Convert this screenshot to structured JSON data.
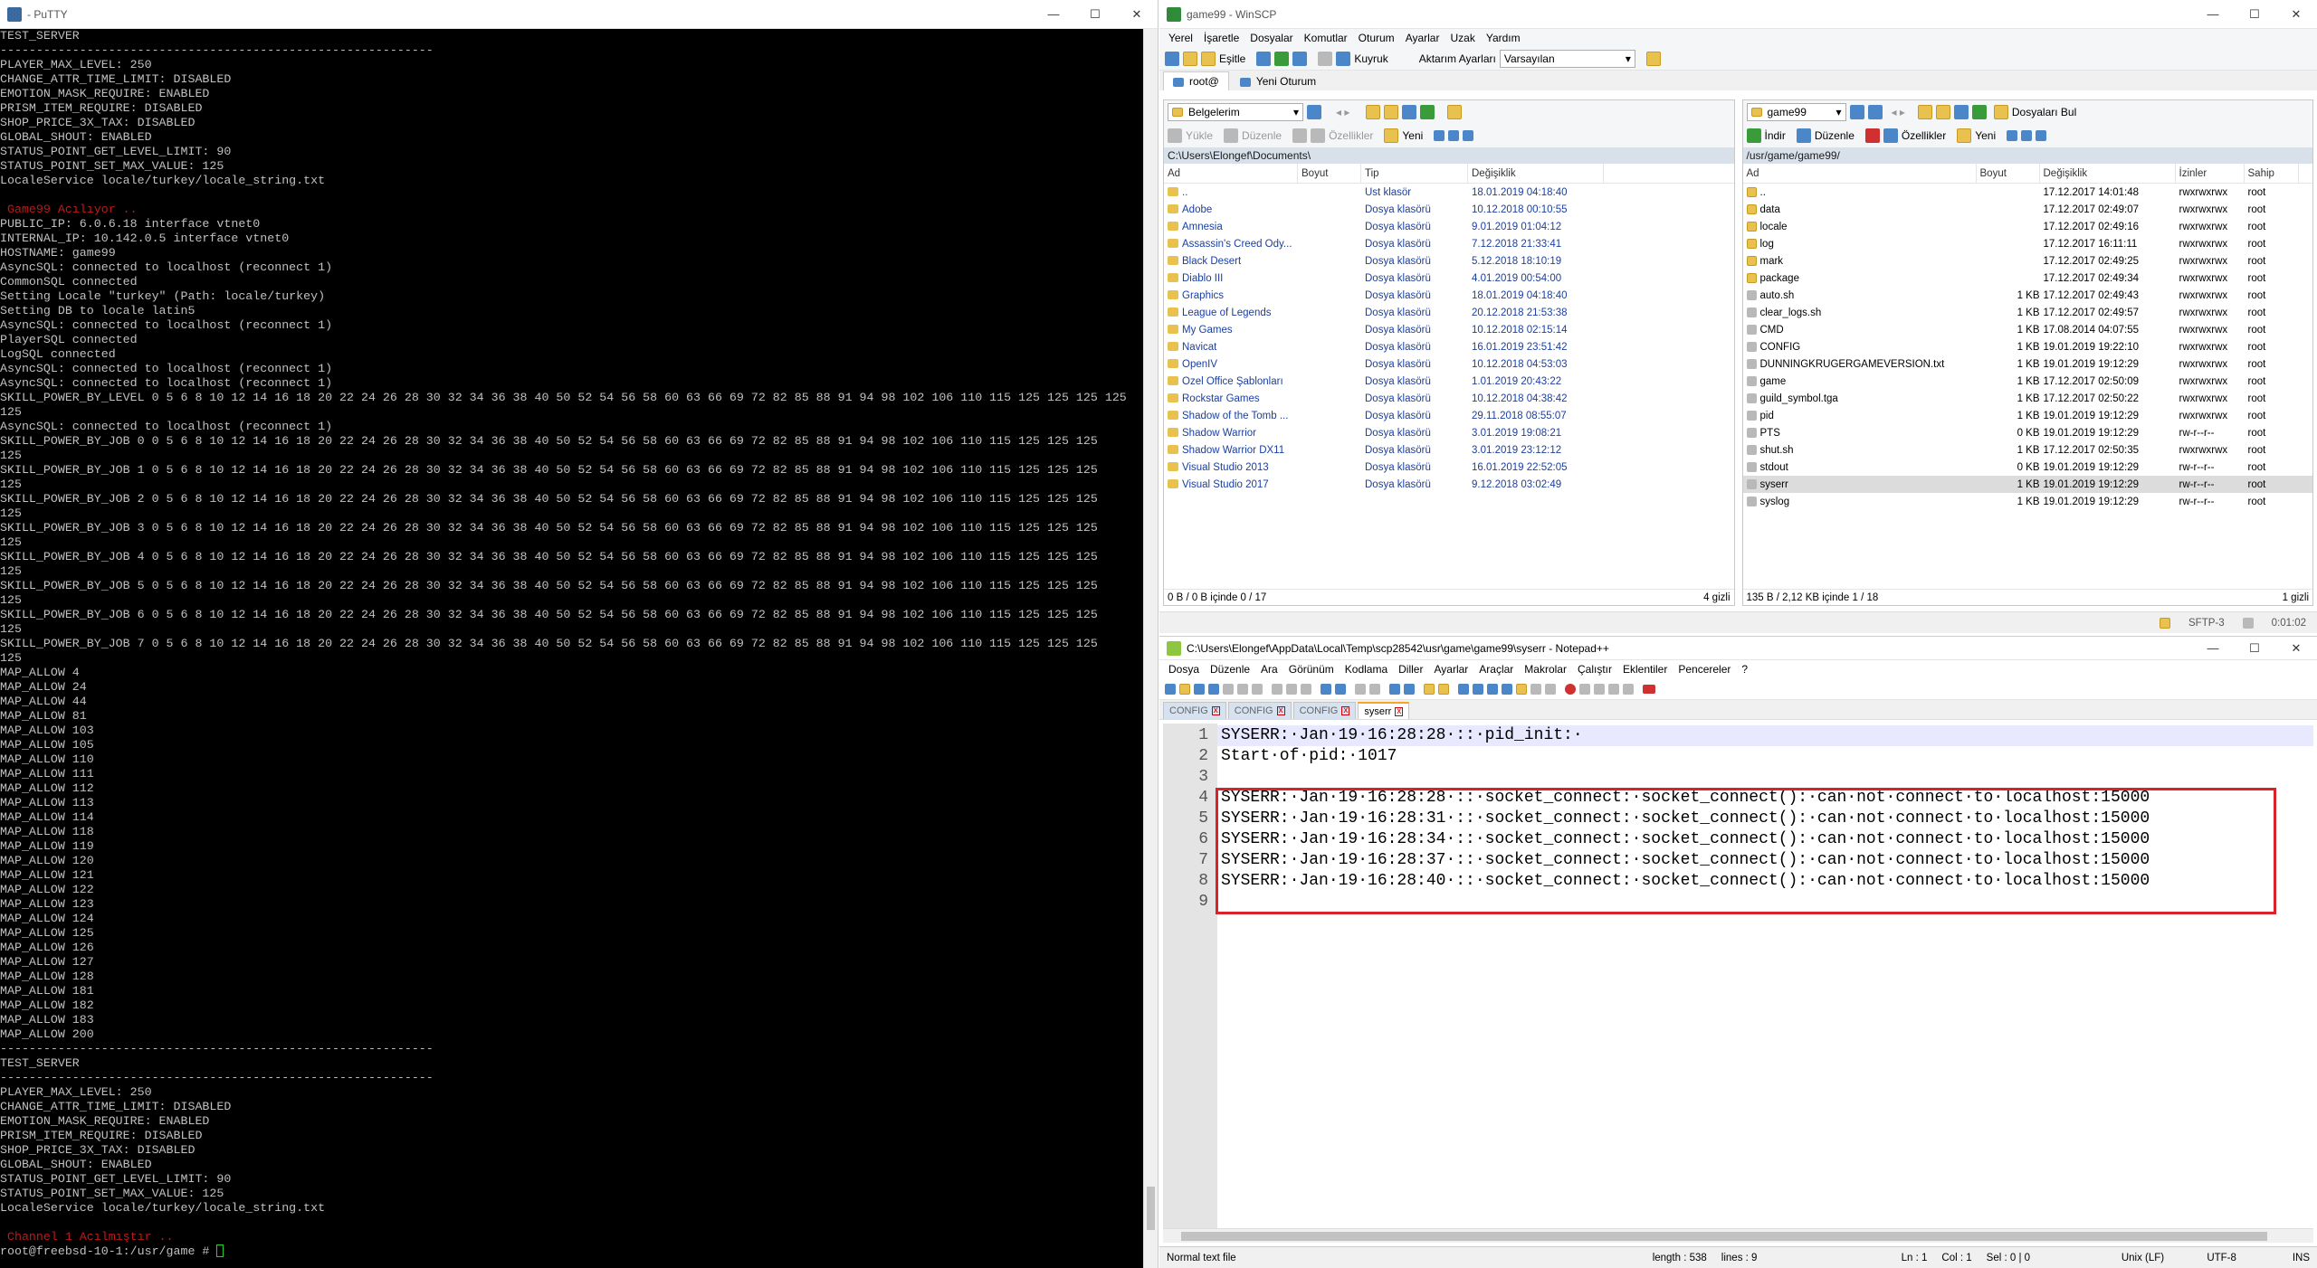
{
  "putty": {
    "title": "- PuTTY",
    "controls": {
      "minimize": "—",
      "maximize": "☐",
      "close": "✕"
    },
    "lines": [
      {
        "t": "TEST_SERVER"
      },
      {
        "t": "------------------------------------------------------------"
      },
      {
        "t": "PLAYER_MAX_LEVEL: 250"
      },
      {
        "t": "CHANGE_ATTR_TIME_LIMIT: DISABLED"
      },
      {
        "t": "EMOTION_MASK_REQUIRE: ENABLED"
      },
      {
        "t": "PRISM_ITEM_REQUIRE: DISABLED"
      },
      {
        "t": "SHOP_PRICE_3X_TAX: DISABLED"
      },
      {
        "t": "GLOBAL_SHOUT: ENABLED"
      },
      {
        "t": "STATUS_POINT_GET_LEVEL_LIMIT: 90"
      },
      {
        "t": "STATUS_POINT_SET_MAX_VALUE: 125"
      },
      {
        "t": "LocaleService locale/turkey/locale_string.txt"
      },
      {
        "t": ""
      },
      {
        "t": " Game99 Acılıyor ..",
        "red": true
      },
      {
        "t": "PUBLIC_IP: 6.0.6.18 interface vtnet0"
      },
      {
        "t": "INTERNAL_IP: 10.142.0.5 interface vtnet0"
      },
      {
        "t": "HOSTNAME: game99"
      },
      {
        "t": "AsyncSQL: connected to localhost (reconnect 1)"
      },
      {
        "t": "CommonSQL connected"
      },
      {
        "t": "Setting Locale \"turkey\" (Path: locale/turkey)"
      },
      {
        "t": "Setting DB to locale latin5"
      },
      {
        "t": "AsyncSQL: connected to localhost (reconnect 1)"
      },
      {
        "t": "PlayerSQL connected"
      },
      {
        "t": "LogSQL connected"
      },
      {
        "t": "AsyncSQL: connected to localhost (reconnect 1)"
      },
      {
        "t": "AsyncSQL: connected to localhost (reconnect 1)"
      },
      {
        "t": "SKILL_POWER_BY_LEVEL 0 5 6 8 10 12 14 16 18 20 22 24 26 28 30 32 34 36 38 40 50 52 54 56 58 60 63 66 69 72 82 85 88 91 94 98 102 106 110 115 125 125 125 125"
      },
      {
        "t": "125"
      },
      {
        "t": "AsyncSQL: connected to localhost (reconnect 1)"
      },
      {
        "t": "SKILL_POWER_BY_JOB 0 0 5 6 8 10 12 14 16 18 20 22 24 26 28 30 32 34 36 38 40 50 52 54 56 58 60 63 66 69 72 82 85 88 91 94 98 102 106 110 115 125 125 125"
      },
      {
        "t": "125"
      },
      {
        "t": "SKILL_POWER_BY_JOB 1 0 5 6 8 10 12 14 16 18 20 22 24 26 28 30 32 34 36 38 40 50 52 54 56 58 60 63 66 69 72 82 85 88 91 94 98 102 106 110 115 125 125 125"
      },
      {
        "t": "125"
      },
      {
        "t": "SKILL_POWER_BY_JOB 2 0 5 6 8 10 12 14 16 18 20 22 24 26 28 30 32 34 36 38 40 50 52 54 56 58 60 63 66 69 72 82 85 88 91 94 98 102 106 110 115 125 125 125"
      },
      {
        "t": "125"
      },
      {
        "t": "SKILL_POWER_BY_JOB 3 0 5 6 8 10 12 14 16 18 20 22 24 26 28 30 32 34 36 38 40 50 52 54 56 58 60 63 66 69 72 82 85 88 91 94 98 102 106 110 115 125 125 125"
      },
      {
        "t": "125"
      },
      {
        "t": "SKILL_POWER_BY_JOB 4 0 5 6 8 10 12 14 16 18 20 22 24 26 28 30 32 34 36 38 40 50 52 54 56 58 60 63 66 69 72 82 85 88 91 94 98 102 106 110 115 125 125 125"
      },
      {
        "t": "125"
      },
      {
        "t": "SKILL_POWER_BY_JOB 5 0 5 6 8 10 12 14 16 18 20 22 24 26 28 30 32 34 36 38 40 50 52 54 56 58 60 63 66 69 72 82 85 88 91 94 98 102 106 110 115 125 125 125"
      },
      {
        "t": "125"
      },
      {
        "t": "SKILL_POWER_BY_JOB 6 0 5 6 8 10 12 14 16 18 20 22 24 26 28 30 32 34 36 38 40 50 52 54 56 58 60 63 66 69 72 82 85 88 91 94 98 102 106 110 115 125 125 125"
      },
      {
        "t": "125"
      },
      {
        "t": "SKILL_POWER_BY_JOB 7 0 5 6 8 10 12 14 16 18 20 22 24 26 28 30 32 34 36 38 40 50 52 54 56 58 60 63 66 69 72 82 85 88 91 94 98 102 106 110 115 125 125 125"
      },
      {
        "t": "125"
      },
      {
        "t": "MAP_ALLOW 4"
      },
      {
        "t": "MAP_ALLOW 24"
      },
      {
        "t": "MAP_ALLOW 44"
      },
      {
        "t": "MAP_ALLOW 81"
      },
      {
        "t": "MAP_ALLOW 103"
      },
      {
        "t": "MAP_ALLOW 105"
      },
      {
        "t": "MAP_ALLOW 110"
      },
      {
        "t": "MAP_ALLOW 111"
      },
      {
        "t": "MAP_ALLOW 112"
      },
      {
        "t": "MAP_ALLOW 113"
      },
      {
        "t": "MAP_ALLOW 114"
      },
      {
        "t": "MAP_ALLOW 118"
      },
      {
        "t": "MAP_ALLOW 119"
      },
      {
        "t": "MAP_ALLOW 120"
      },
      {
        "t": "MAP_ALLOW 121"
      },
      {
        "t": "MAP_ALLOW 122"
      },
      {
        "t": "MAP_ALLOW 123"
      },
      {
        "t": "MAP_ALLOW 124"
      },
      {
        "t": "MAP_ALLOW 125"
      },
      {
        "t": "MAP_ALLOW 126"
      },
      {
        "t": "MAP_ALLOW 127"
      },
      {
        "t": "MAP_ALLOW 128"
      },
      {
        "t": "MAP_ALLOW 181"
      },
      {
        "t": "MAP_ALLOW 182"
      },
      {
        "t": "MAP_ALLOW 183"
      },
      {
        "t": "MAP_ALLOW 200"
      },
      {
        "t": "------------------------------------------------------------"
      },
      {
        "t": "TEST_SERVER"
      },
      {
        "t": "------------------------------------------------------------"
      },
      {
        "t": "PLAYER_MAX_LEVEL: 250"
      },
      {
        "t": "CHANGE_ATTR_TIME_LIMIT: DISABLED"
      },
      {
        "t": "EMOTION_MASK_REQUIRE: ENABLED"
      },
      {
        "t": "PRISM_ITEM_REQUIRE: DISABLED"
      },
      {
        "t": "SHOP_PRICE_3X_TAX: DISABLED"
      },
      {
        "t": "GLOBAL_SHOUT: ENABLED"
      },
      {
        "t": "STATUS_POINT_GET_LEVEL_LIMIT: 90"
      },
      {
        "t": "STATUS_POINT_SET_MAX_VALUE: 125"
      },
      {
        "t": "LocaleService locale/turkey/locale_string.txt"
      },
      {
        "t": ""
      },
      {
        "t": " Channel 1 Acılmıştır ..",
        "red": true
      }
    ],
    "prompt": "root@freebsd-10-1:/usr/game # "
  },
  "winscp": {
    "title": "game99 - WinSCP",
    "menu": [
      "Yerel",
      "İşaretle",
      "Dosyalar",
      "Komutlar",
      "Oturum",
      "Ayarlar",
      "Uzak",
      "Yardım"
    ],
    "toolbar": {
      "sync_label": "Eşitle",
      "queue_label": "Kuyruk",
      "transfer_label": "Aktarım Ayarları",
      "transfer_value": "Varsayılan"
    },
    "session_tab": "root@",
    "new_session": "Yeni Oturum",
    "local": {
      "drive": "Belgelerim",
      "actions": {
        "upload": "Yükle",
        "edit": "Düzenle",
        "props": "Özellikler",
        "new": "Yeni"
      },
      "path": "C:\\Users\\Elongef\\Documents\\",
      "columns": [
        "Ad",
        "Boyut",
        "Tip",
        "Değişiklik"
      ],
      "rows": [
        {
          "name": "..",
          "size": "",
          "type": "Üst klasör",
          "date": "18.01.2019  04:18:40"
        },
        {
          "name": "Adobe",
          "size": "",
          "type": "Dosya klasörü",
          "date": "10.12.2018  00:10:55"
        },
        {
          "name": "Amnesia",
          "size": "",
          "type": "Dosya klasörü",
          "date": "9.01.2019  01:04:12"
        },
        {
          "name": "Assassin's Creed Ody...",
          "size": "",
          "type": "Dosya klasörü",
          "date": "7.12.2018  21:33:41"
        },
        {
          "name": "Black Desert",
          "size": "",
          "type": "Dosya klasörü",
          "date": "5.12.2018  18:10:19"
        },
        {
          "name": "Diablo III",
          "size": "",
          "type": "Dosya klasörü",
          "date": "4.01.2019  00:54:00"
        },
        {
          "name": "Graphics",
          "size": "",
          "type": "Dosya klasörü",
          "date": "18.01.2019  04:18:40"
        },
        {
          "name": "League of Legends",
          "size": "",
          "type": "Dosya klasörü",
          "date": "20.12.2018  21:53:38"
        },
        {
          "name": "My Games",
          "size": "",
          "type": "Dosya klasörü",
          "date": "10.12.2018  02:15:14"
        },
        {
          "name": "Navicat",
          "size": "",
          "type": "Dosya klasörü",
          "date": "16.01.2019  23:51:42"
        },
        {
          "name": "OpenIV",
          "size": "",
          "type": "Dosya klasörü",
          "date": "10.12.2018  04:53:03"
        },
        {
          "name": "Özel Office Şablonları",
          "size": "",
          "type": "Dosya klasörü",
          "date": "1.01.2019  20:43:22"
        },
        {
          "name": "Rockstar Games",
          "size": "",
          "type": "Dosya klasörü",
          "date": "10.12.2018  04:38:42"
        },
        {
          "name": "Shadow of the Tomb ...",
          "size": "",
          "type": "Dosya klasörü",
          "date": "29.11.2018  08:55:07"
        },
        {
          "name": "Shadow Warrior",
          "size": "",
          "type": "Dosya klasörü",
          "date": "3.01.2019  19:08:21"
        },
        {
          "name": "Shadow Warrior DX11",
          "size": "",
          "type": "Dosya klasörü",
          "date": "3.01.2019  23:12:12"
        },
        {
          "name": "Visual Studio 2013",
          "size": "",
          "type": "Dosya klasörü",
          "date": "16.01.2019  22:52:05"
        },
        {
          "name": "Visual Studio 2017",
          "size": "",
          "type": "Dosya klasörü",
          "date": "9.12.2018  03:02:49"
        }
      ],
      "status_left": "0 B / 0 B içinde 0 / 17",
      "status_right": "4 gizli"
    },
    "remote": {
      "drive": "game99",
      "actions": {
        "download": "İndir",
        "edit": "Düzenle",
        "props": "Özellikler",
        "new": "Yeni",
        "find": "Dosyaları Bul"
      },
      "path": "/usr/game/game99/",
      "columns": [
        "Ad",
        "Boyut",
        "Değişiklik",
        "İzinler",
        "Sahip"
      ],
      "rows": [
        {
          "name": "..",
          "size": "",
          "date": "17.12.2017 14:01:48",
          "perm": "rwxrwxrwx",
          "owner": "root"
        },
        {
          "name": "data",
          "size": "",
          "date": "17.12.2017 02:49:07",
          "perm": "rwxrwxrwx",
          "owner": "root"
        },
        {
          "name": "locale",
          "size": "",
          "date": "17.12.2017 02:49:16",
          "perm": "rwxrwxrwx",
          "owner": "root"
        },
        {
          "name": "log",
          "size": "",
          "date": "17.12.2017 16:11:11",
          "perm": "rwxrwxrwx",
          "owner": "root"
        },
        {
          "name": "mark",
          "size": "",
          "date": "17.12.2017 02:49:25",
          "perm": "rwxrwxrwx",
          "owner": "root"
        },
        {
          "name": "package",
          "size": "",
          "date": "17.12.2017 02:49:34",
          "perm": "rwxrwxrwx",
          "owner": "root"
        },
        {
          "name": "auto.sh",
          "size": "1 KB",
          "date": "17.12.2017 02:49:43",
          "perm": "rwxrwxrwx",
          "owner": "root"
        },
        {
          "name": "clear_logs.sh",
          "size": "1 KB",
          "date": "17.12.2017 02:49:57",
          "perm": "rwxrwxrwx",
          "owner": "root"
        },
        {
          "name": "CMD",
          "size": "1 KB",
          "date": "17.08.2014 04:07:55",
          "perm": "rwxrwxrwx",
          "owner": "root"
        },
        {
          "name": "CONFIG",
          "size": "1 KB",
          "date": "19.01.2019 19:22:10",
          "perm": "rwxrwxrwx",
          "owner": "root"
        },
        {
          "name": "DUNNINGKRUGERGAMEVERSION.txt",
          "size": "1 KB",
          "date": "19.01.2019 19:12:29",
          "perm": "rwxrwxrwx",
          "owner": "root"
        },
        {
          "name": "game",
          "size": "1 KB",
          "date": "17.12.2017 02:50:09",
          "perm": "rwxrwxrwx",
          "owner": "root"
        },
        {
          "name": "guild_symbol.tga",
          "size": "1 KB",
          "date": "17.12.2017 02:50:22",
          "perm": "rwxrwxrwx",
          "owner": "root"
        },
        {
          "name": "pid",
          "size": "1 KB",
          "date": "19.01.2019 19:12:29",
          "perm": "rwxrwxrwx",
          "owner": "root"
        },
        {
          "name": "PTS",
          "size": "0 KB",
          "date": "19.01.2019 19:12:29",
          "perm": "rw-r--r--",
          "owner": "root"
        },
        {
          "name": "shut.sh",
          "size": "1 KB",
          "date": "17.12.2017 02:50:35",
          "perm": "rwxrwxrwx",
          "owner": "root"
        },
        {
          "name": "stdout",
          "size": "0 KB",
          "date": "19.01.2019 19:12:29",
          "perm": "rw-r--r--",
          "owner": "root"
        },
        {
          "name": "syserr",
          "size": "1 KB",
          "date": "19.01.2019 19:12:29",
          "perm": "rw-r--r--",
          "owner": "root",
          "sel": true
        },
        {
          "name": "syslog",
          "size": "1 KB",
          "date": "19.01.2019 19:12:29",
          "perm": "rw-r--r--",
          "owner": "root"
        }
      ],
      "status_left": "135 B / 2,12 KB içinde 1 / 18",
      "status_right": "1 gizli"
    },
    "bottom": {
      "protocol": "SFTP-3",
      "time": "0:01:02"
    }
  },
  "notepad": {
    "title": "C:\\Users\\Elongef\\AppData\\Local\\Temp\\scp28542\\usr\\game\\game99\\syserr - Notepad++",
    "menu": [
      "Dosya",
      "Düzenle",
      "Ara",
      "Görünüm",
      "Kodlama",
      "Diller",
      "Ayarlar",
      "Araçlar",
      "Makrolar",
      "Çalıştır",
      "Eklentiler",
      "Pencereler",
      "?"
    ],
    "tabs": [
      "CONFIG",
      "CONFIG",
      "CONFIG",
      "syserr"
    ],
    "lines": [
      "SYSERR:·Jan·19·16:28:28·::·pid_init:·",
      "Start·of·pid:·1017",
      "",
      "SYSERR:·Jan·19·16:28:28·::·socket_connect:·socket_connect():·can·not·connect·to·localhost:15000",
      "SYSERR:·Jan·19·16:28:31·::·socket_connect:·socket_connect():·can·not·connect·to·localhost:15000",
      "SYSERR:·Jan·19·16:28:34·::·socket_connect:·socket_connect():·can·not·connect·to·localhost:15000",
      "SYSERR:·Jan·19·16:28:37·::·socket_connect:·socket_connect():·can·not·connect·to·localhost:15000",
      "SYSERR:·Jan·19·16:28:40·::·socket_connect:·socket_connect():·can·not·connect·to·localhost:15000",
      ""
    ],
    "status": {
      "type": "Normal text file",
      "length": "length : 538",
      "lines": "lines : 9",
      "ln": "Ln : 1",
      "col": "Col : 1",
      "sel": "Sel : 0 | 0",
      "eol": "Unix (LF)",
      "enc": "UTF-8",
      "ins": "INS"
    },
    "colors": {
      "highlight_box": "#d9232b"
    }
  }
}
